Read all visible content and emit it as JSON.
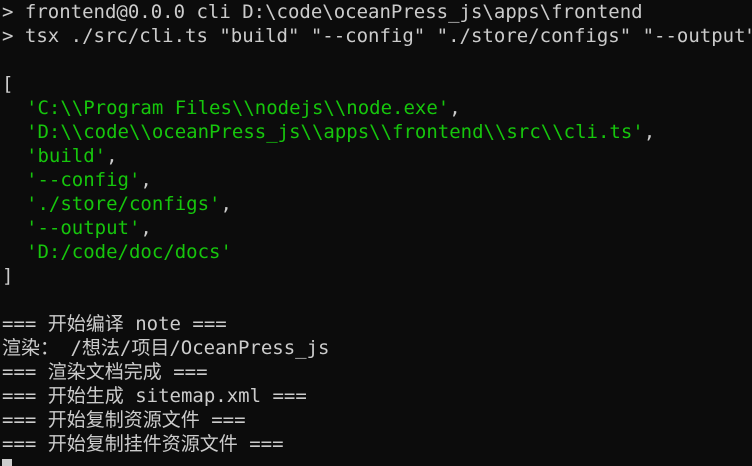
{
  "terminal": {
    "prompt": {
      "line1": "> frontend@0.0.0 cli D:\\code\\oceanPress_js\\apps\\frontend",
      "line2": "> tsx ./src/cli.ts \"build\" \"--config\" \"./store/configs\" \"--output\" \"D:/code/doc/docs\""
    },
    "array": {
      "open": "[",
      "items": [
        "'C:\\\\Program Files\\\\nodejs\\\\node.exe'",
        "'D:\\\\code\\\\oceanPress_js\\\\apps\\\\frontend\\\\src\\\\cli.ts'",
        "'build'",
        "'--config'",
        "'./store/configs'",
        "'--output'",
        "'D:/code/doc/docs'"
      ],
      "separator": ",",
      "close": "]"
    },
    "log": [
      "=== 开始编译 note ===",
      "渲染： /想法/项目/OceanPress_js",
      "=== 渲染文档完成 ===",
      "=== 开始生成 sitemap.xml ===",
      "=== 开始复制资源文件 ===",
      "=== 开始复制挂件资源文件 ==="
    ]
  }
}
